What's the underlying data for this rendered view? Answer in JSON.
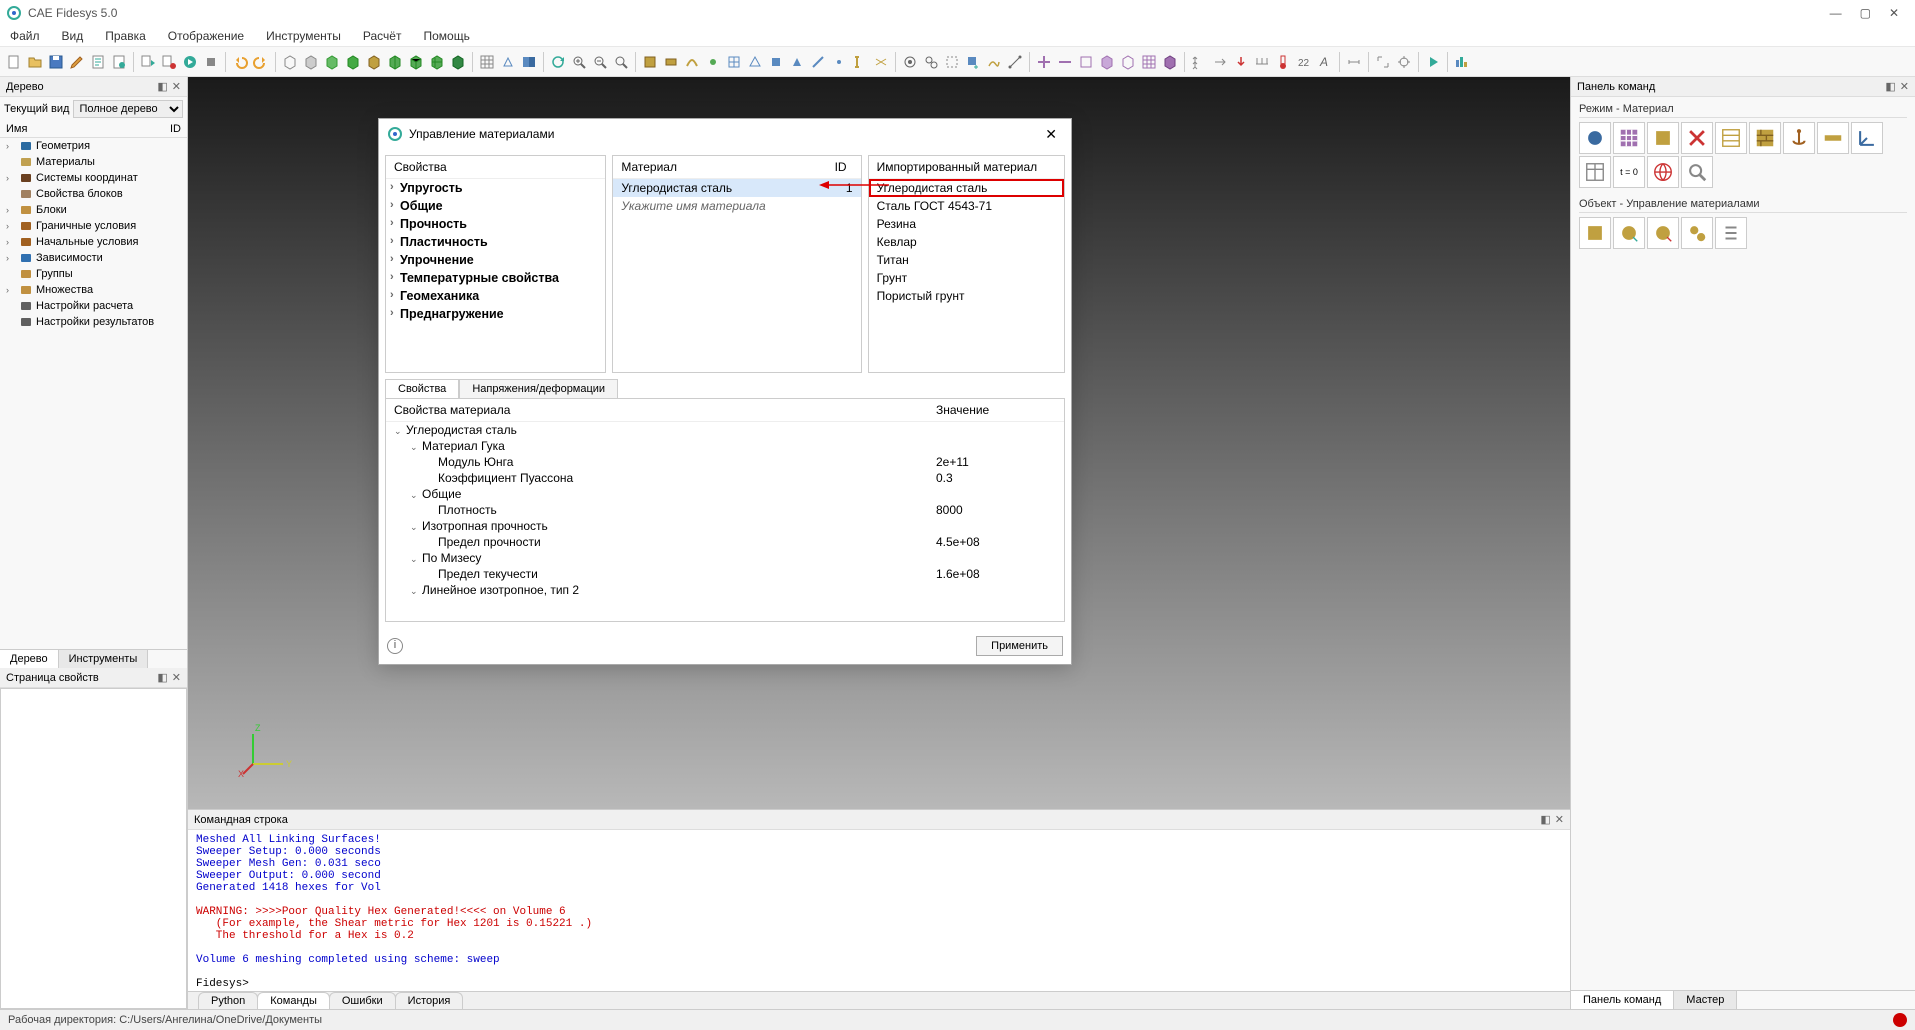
{
  "app": {
    "title": "CAE Fidesys 5.0"
  },
  "menu": [
    "Файл",
    "Вид",
    "Правка",
    "Отображение",
    "Инструменты",
    "Расчёт",
    "Помощь"
  ],
  "left_panel": {
    "title": "Дерево"
  },
  "view_select": {
    "label": "Текущий вид",
    "value": "Полное дерево"
  },
  "tree_cols": {
    "name": "Имя",
    "id": "ID"
  },
  "tree_items": [
    {
      "label": "Геометрия",
      "exp": true,
      "color": "#2a6aa0"
    },
    {
      "label": "Материалы",
      "exp": false,
      "color": "#c0a050"
    },
    {
      "label": "Системы координат",
      "exp": true,
      "color": "#6a4020"
    },
    {
      "label": "Свойства блоков",
      "exp": false,
      "color": "#a08060"
    },
    {
      "label": "Блоки",
      "exp": true,
      "color": "#c09040"
    },
    {
      "label": "Граничные условия",
      "exp": true,
      "color": "#a06020"
    },
    {
      "label": "Начальные условия",
      "exp": true,
      "color": "#a06020"
    },
    {
      "label": "Зависимости",
      "exp": true,
      "color": "#3070b0"
    },
    {
      "label": "Группы",
      "exp": false,
      "color": "#c09040"
    },
    {
      "label": "Множества",
      "exp": true,
      "color": "#c09040"
    },
    {
      "label": "Настройки расчета",
      "exp": false,
      "color": "#606060"
    },
    {
      "label": "Настройки результатов",
      "exp": false,
      "color": "#606060"
    }
  ],
  "left_tabs": {
    "tree": "Дерево",
    "tools": "Инструменты"
  },
  "prop_title": "Страница свойств",
  "cmd_title": "Командная строка",
  "cmd_lines": [
    {
      "cls": "blue",
      "text": "Meshed All Linking Surfaces!"
    },
    {
      "cls": "blue",
      "text": "Sweeper Setup: 0.000 seconds"
    },
    {
      "cls": "blue",
      "text": "Sweeper Mesh Gen: 0.031 seco"
    },
    {
      "cls": "blue",
      "text": "Sweeper Output: 0.000 second"
    },
    {
      "cls": "blue",
      "text": "Generated 1418 hexes for Vol"
    },
    {
      "cls": "",
      "text": ""
    },
    {
      "cls": "red",
      "text": "WARNING: >>>>Poor Quality Hex Generated!<<<< on Volume 6"
    },
    {
      "cls": "red",
      "text": "   (For example, the Shear metric for Hex 1201 is 0.15221 .)"
    },
    {
      "cls": "red",
      "text": "   The threshold for a Hex is 0.2"
    },
    {
      "cls": "",
      "text": ""
    },
    {
      "cls": "blue",
      "text": "Volume 6 meshing completed using scheme: sweep"
    },
    {
      "cls": "",
      "text": ""
    },
    {
      "cls": "",
      "text": "Fidesys>"
    }
  ],
  "cmd_tabs": [
    "Python",
    "Команды",
    "Ошибки",
    "История"
  ],
  "right_title": "Панель команд",
  "mode_title": "Режим - Материал",
  "object_title": "Объект - Управление материалами",
  "right_tabs": {
    "cmd": "Панель команд",
    "master": "Мастер"
  },
  "status": "Рабочая директория: C:/Users/Ангелина/OneDrive/Документы",
  "dialog": {
    "title": "Управление материалами",
    "props_hdr": "Свойства",
    "props": [
      "Упругость",
      "Общие",
      "Прочность",
      "Пластичность",
      "Упрочнение",
      "Температурные свойства",
      "Геомеханика",
      "Преднагружение"
    ],
    "mat_hdr": "Материал",
    "mat_id_hdr": "ID",
    "mat_row": {
      "name": "Углеродистая сталь",
      "id": "1"
    },
    "mat_placeholder": "Укажите имя материала",
    "imp_hdr": "Импортированный материал",
    "imp_items": [
      "Углеродистая сталь",
      "Сталь ГОСТ 4543-71",
      "Резина",
      "Кевлар",
      "Титан",
      "Грунт",
      "Пористый грунт"
    ],
    "tabs": {
      "props": "Свойства",
      "stress": "Напряжения/деформации"
    },
    "tree_hdr": {
      "name": "Свойства материала",
      "val": "Значение"
    },
    "tree": [
      {
        "ind": 0,
        "chev": "⌄",
        "name": "Углеродистая сталь",
        "val": ""
      },
      {
        "ind": 1,
        "chev": "⌄",
        "name": "Материал Гука",
        "val": ""
      },
      {
        "ind": 2,
        "chev": "",
        "name": "Модуль Юнга",
        "val": "2e+11"
      },
      {
        "ind": 2,
        "chev": "",
        "name": "Коэффициент Пуассона",
        "val": "0.3"
      },
      {
        "ind": 1,
        "chev": "⌄",
        "name": "Общие",
        "val": ""
      },
      {
        "ind": 2,
        "chev": "",
        "name": "Плотность",
        "val": "8000"
      },
      {
        "ind": 1,
        "chev": "⌄",
        "name": "Изотропная прочность",
        "val": ""
      },
      {
        "ind": 2,
        "chev": "",
        "name": "Предел прочности",
        "val": "4.5e+08"
      },
      {
        "ind": 1,
        "chev": "⌄",
        "name": "По Мизесу",
        "val": ""
      },
      {
        "ind": 2,
        "chev": "",
        "name": "Предел текучести",
        "val": "1.6e+08"
      },
      {
        "ind": 1,
        "chev": "⌄",
        "name": "Линейное изотропное, тип 2",
        "val": ""
      }
    ],
    "apply": "Применить"
  }
}
